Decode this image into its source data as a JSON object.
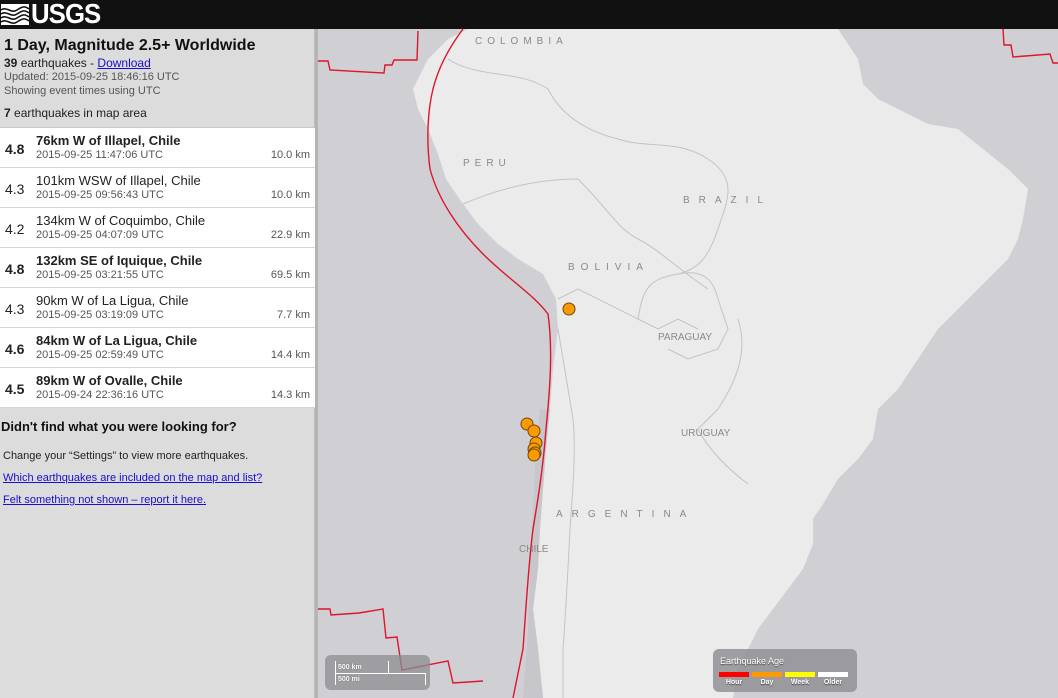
{
  "header": {
    "logo_text": "USGS",
    "logo_icon": "usgs-wave-icon"
  },
  "summary": {
    "title": "1 Day, Magnitude 2.5+ Worldwide",
    "count": "39",
    "count_suffix": " earthquakes - ",
    "download_label": "Download",
    "updated": "Updated: 2015-09-25 18:46:16 UTC",
    "timezone_note": "Showing event times using UTC",
    "in_map_count": "7",
    "in_map_suffix": " earthquakes in map area"
  },
  "quakes": [
    {
      "mag": "4.8",
      "place": "76km W of Illapel, Chile",
      "time": "2015-09-25 11:47:06 UTC",
      "depth": "10.0 km",
      "bold": true
    },
    {
      "mag": "4.3",
      "place": "101km WSW of Illapel, Chile",
      "time": "2015-09-25 09:56:43 UTC",
      "depth": "10.0 km",
      "bold": false
    },
    {
      "mag": "4.2",
      "place": "134km W of Coquimbo, Chile",
      "time": "2015-09-25 04:07:09 UTC",
      "depth": "22.9 km",
      "bold": false
    },
    {
      "mag": "4.8",
      "place": "132km SE of Iquique, Chile",
      "time": "2015-09-25 03:21:55 UTC",
      "depth": "69.5 km",
      "bold": true
    },
    {
      "mag": "4.3",
      "place": "90km W of La Ligua, Chile",
      "time": "2015-09-25 03:19:09 UTC",
      "depth": "7.7 km",
      "bold": false
    },
    {
      "mag": "4.6",
      "place": "84km W of La Ligua, Chile",
      "time": "2015-09-25 02:59:49 UTC",
      "depth": "14.4 km",
      "bold": true
    },
    {
      "mag": "4.5",
      "place": "89km W of Ovalle, Chile",
      "time": "2015-09-24 22:36:16 UTC",
      "depth": "14.3 km",
      "bold": true
    }
  ],
  "help": {
    "heading": "Didn't find what you were looking for?",
    "settings_note": "Change your “Settings” to view more earthquakes.",
    "link_included": "Which earthquakes are included on the map and list?",
    "link_report": "Felt something not shown – report it here."
  },
  "map": {
    "labels": {
      "colombia": "COLOMBIA",
      "peru": "PERU",
      "brazil": "BRAZIL",
      "bolivia": "BOLIVIA",
      "paraguay": "PARAGUAY",
      "uruguay": "URUGUAY",
      "argentina": "ARGENTINA",
      "chile": "CHILE"
    },
    "colors": {
      "ocean": "#d0cfd4",
      "land": "#ebebeb",
      "plate_boundary": "#e0142b",
      "quake_day": "#ff9900"
    },
    "scale": {
      "km_label": "500 km",
      "mi_label": "500 mi"
    },
    "legend": {
      "title": "Earthquake Age",
      "items": [
        {
          "label": "Hour",
          "color": "#ff0000"
        },
        {
          "label": "Day",
          "color": "#ff9900"
        },
        {
          "label": "Week",
          "color": "#ffff00"
        },
        {
          "label": "Older",
          "color": "#ffffff"
        }
      ]
    }
  }
}
